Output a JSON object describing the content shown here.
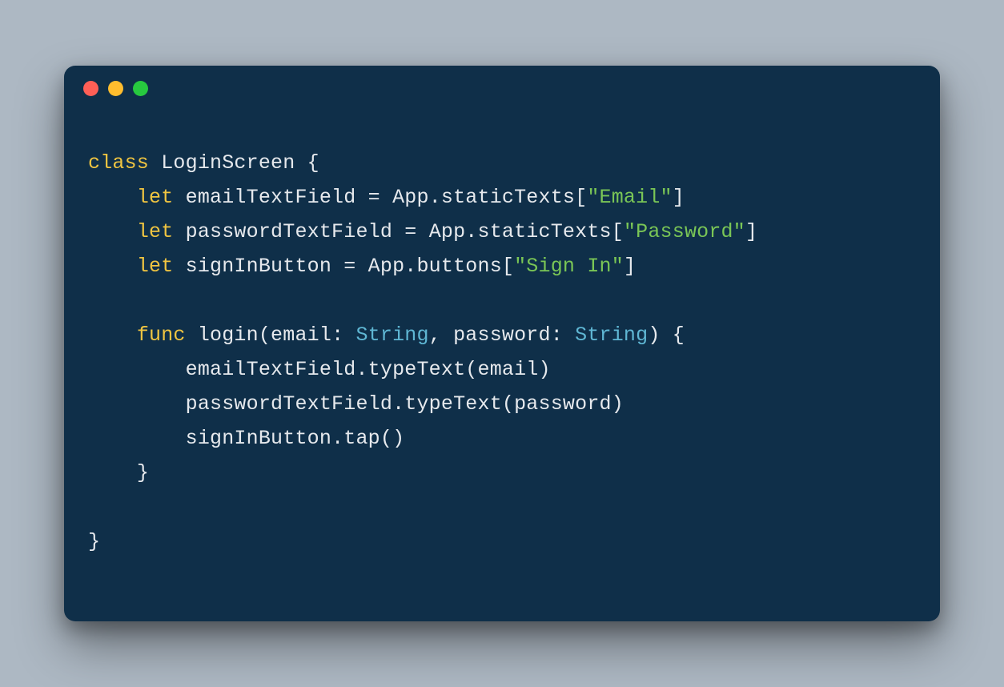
{
  "traffic_lights": {
    "red": "close",
    "yellow": "minimize",
    "green": "zoom"
  },
  "code": {
    "kw_class": "class",
    "ClassName": "LoginScreen",
    "obrace": "{",
    "cbrace": "}",
    "kw_let": "let",
    "kw_func": "func",
    "eq": "=",
    "comma": ",",
    "colon": ":",
    "obracket": "[",
    "cbracket": "]",
    "oparen": "(",
    "cparen": ")",
    "dot": ".",
    "App": "App",
    "staticTexts": "staticTexts",
    "buttons": "buttons",
    "typeText": "typeText",
    "tap": "tap",
    "emailTextField": "emailTextField",
    "passwordTextField": "passwordTextField",
    "signInButton": "signInButton",
    "login": "login",
    "paramEmail": "email",
    "paramPassword": "password",
    "TypeString": "String",
    "strEmail": "\"Email\"",
    "strPassword": "\"Password\"",
    "strSignIn": "\"Sign In\""
  }
}
